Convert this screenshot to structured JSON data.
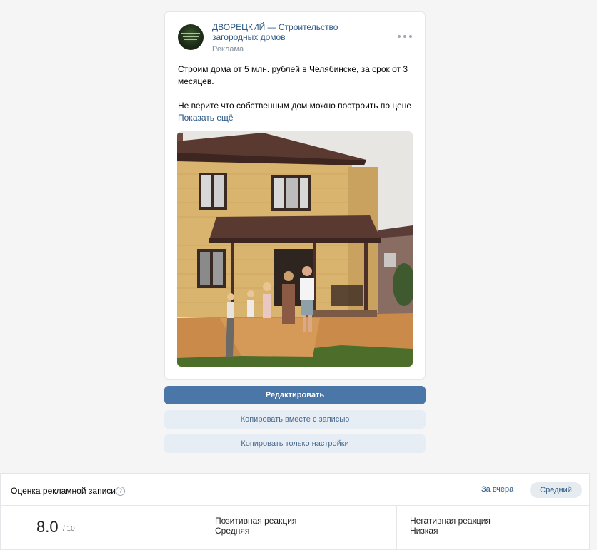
{
  "post": {
    "author": "ДВОРЕЦКИЙ — Строительство загородных домов",
    "ad_label": "Реклама",
    "text_line1": "Строим дома от 5 млн. рублей в Челябинске, за срок от 3 месяцев.",
    "text_line2": "Не верите что собственным дом можно построить по цене",
    "show_more": "Показать ещё"
  },
  "actions": {
    "edit": "Редактировать",
    "copy_with_post": "Копировать вместе с записью",
    "copy_settings_only": "Копировать только настройки"
  },
  "score": {
    "title": "Оценка рекламной записи",
    "help": "?",
    "period": "За вчера",
    "level": "Средний",
    "value": "8.0",
    "max": "/ 10",
    "positive_label": "Позитивная реакция",
    "positive_value": "Средняя",
    "negative_label": "Негативная реакция",
    "negative_value": "Низкая"
  },
  "colors": {
    "link": "#2a5885",
    "primary_button": "#4a76a8",
    "secondary_button": "#e6edf5"
  },
  "icons": {
    "more": "more-horizontal-icon",
    "help": "question-circle-icon"
  }
}
